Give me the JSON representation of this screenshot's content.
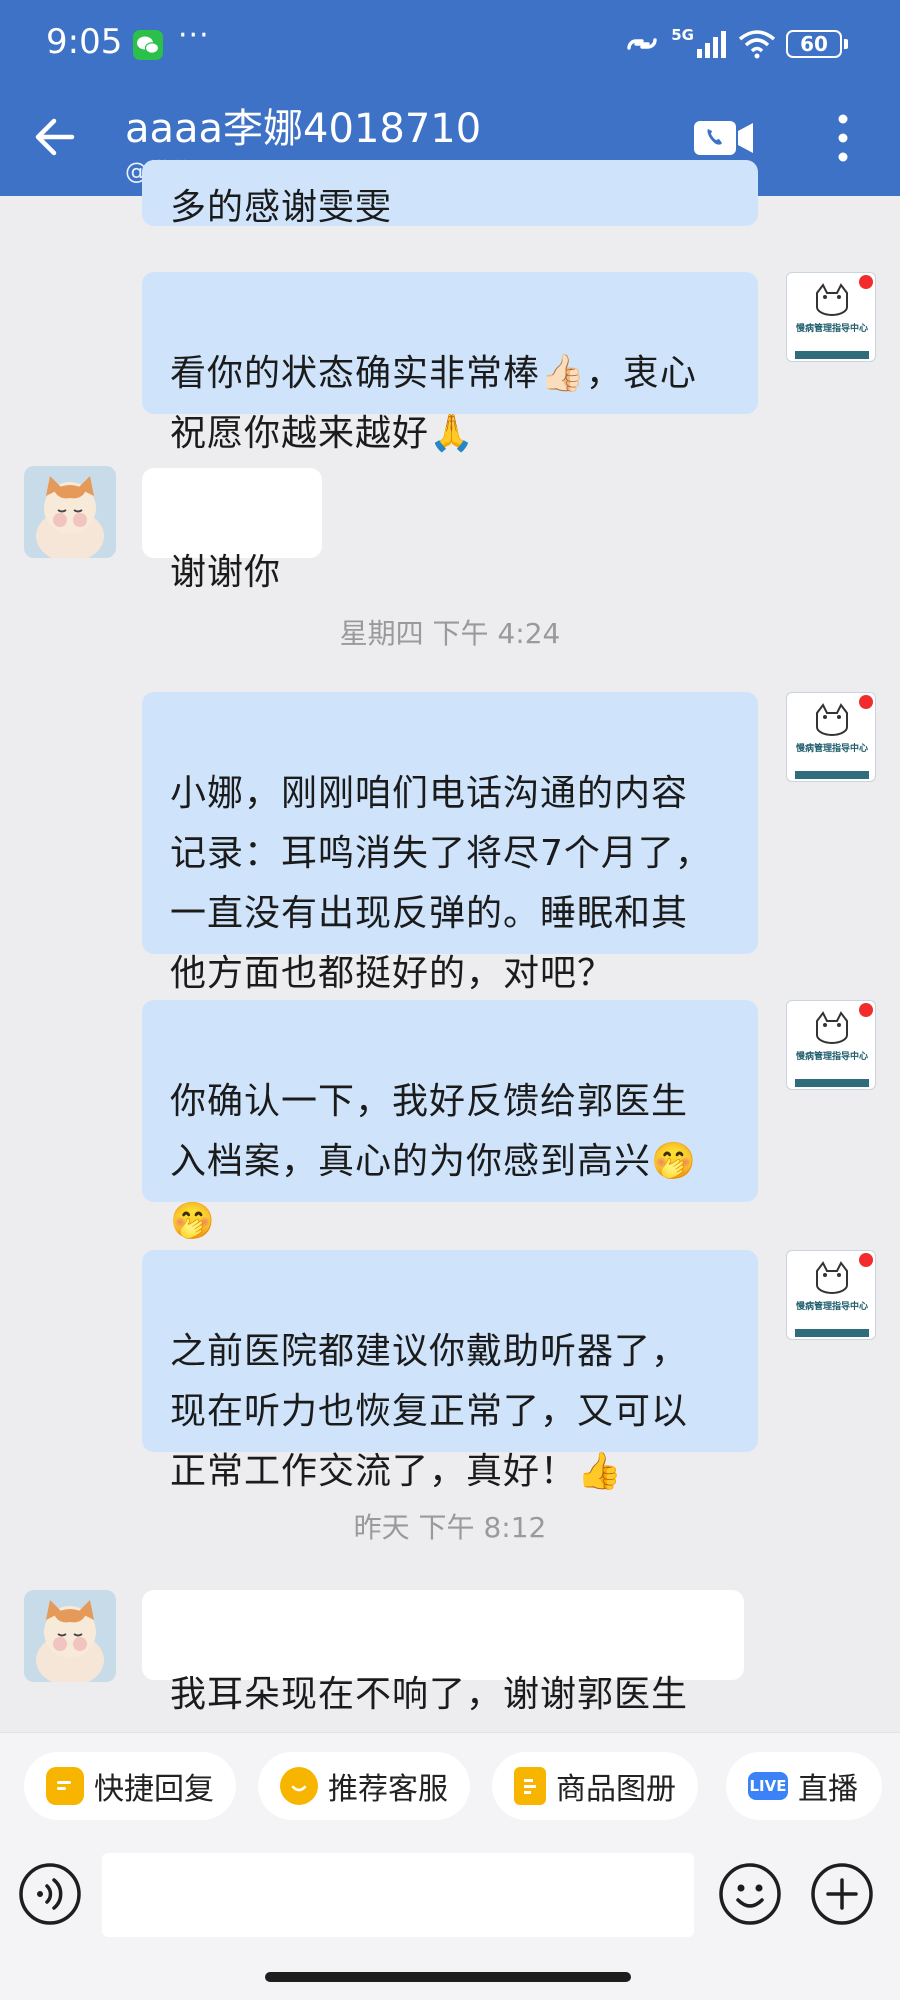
{
  "status_bar": {
    "time": "9:05",
    "more": "···",
    "network": "5G",
    "battery": "60"
  },
  "header": {
    "title": "aaaa李娜4018710",
    "subtitle": "@微信",
    "back_icon": "back-arrow-icon",
    "call_icon": "video-call-icon",
    "menu_icon": "more-vertical-icon"
  },
  "messages": {
    "partial_top": "多的感谢雯雯",
    "m1": "看你的状态确实非常棒👍🏻，衷心\n祝愿你越来越好🙏",
    "m2": "谢谢你",
    "sep1": "星期四  下午 4:24",
    "m3": "小娜，刚刚咱们电话沟通的内容\n记录：耳鸣消失了将尽7个月了，\n一直没有出现反弹的。睡眠和其\n他方面也都挺好的，对吧？",
    "m4": "你确认一下，我好反馈给郭医生\n入档案，真心的为你感到高兴🤭\n🤭",
    "m5": "之前医院都建议你戴助听器了，\n现在听力也恢复正常了，又可以\n正常工作交流了，真好！👍",
    "sep2": "昨天  下午 8:12",
    "m6": "我耳朵现在不响了，谢谢郭医生"
  },
  "org_avatar": {
    "name": "慢病管理指导中心"
  },
  "quick_actions": [
    {
      "label": "快捷回复",
      "icon": "quick-reply-icon"
    },
    {
      "label": "推荐客服",
      "icon": "service-icon"
    },
    {
      "label": "商品图册",
      "icon": "catalog-icon"
    },
    {
      "label": "直播",
      "icon": "live-icon",
      "badge": "LIVE"
    }
  ],
  "composer": {
    "placeholder": "",
    "voice_icon": "voice-icon",
    "emoji_icon": "emoji-icon",
    "plus_icon": "plus-icon"
  },
  "colors": {
    "header": "#3e72c6",
    "outgoing_bubble": "#cfe4fb",
    "incoming_bubble": "#ffffff",
    "background": "#ededf0",
    "chip_icon": "#f7b500"
  }
}
